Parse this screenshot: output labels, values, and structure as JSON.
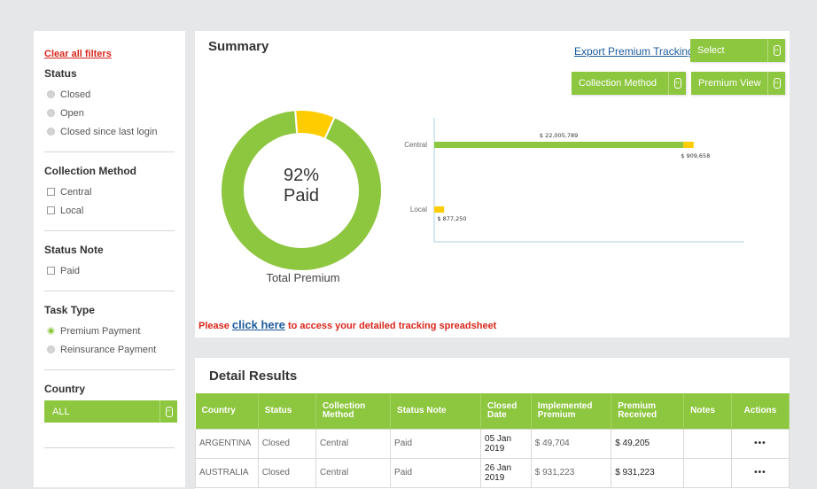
{
  "sidebar": {
    "clear_filters": "Clear all filters",
    "status": {
      "title": "Status",
      "options": [
        "Closed",
        "Open",
        "Closed since last login"
      ]
    },
    "collection_method": {
      "title": "Collection Method",
      "options": [
        "Central",
        "Local"
      ]
    },
    "status_note": {
      "title": "Status Note",
      "options": [
        "Paid"
      ]
    },
    "task_type": {
      "title": "Task Type",
      "options": [
        "Premium Payment",
        "Reinsurance Payment"
      ],
      "selected": "Premium Payment"
    },
    "country": {
      "title": "Country",
      "value": "ALL"
    }
  },
  "summary": {
    "title": "Summary",
    "export_link": "Export Premium Tracking",
    "select_label": "Select",
    "collection_method_btn": "Collection Method",
    "premium_view_btn": "Premium View",
    "donut_center": "92% Paid",
    "donut_caption": "Total Premium",
    "note_prefix": "Please ",
    "note_link": "click here",
    "note_suffix": " to access your detailed tracking spreadsheet",
    "colors": {
      "paid": "#8dc63f",
      "unpaid": "#ffcc00",
      "accent": "#8dc63f",
      "link": "#1c5b9c",
      "alert": "#d9261c"
    }
  },
  "chart_data": [
    {
      "type": "pie",
      "title": "Total Premium",
      "labels": [
        "Paid",
        "Unpaid"
      ],
      "values": [
        92,
        8
      ]
    },
    {
      "type": "bar",
      "orientation": "horizontal",
      "categories": [
        "Central",
        "Local"
      ],
      "series": [
        {
          "values": [
            22005789,
            0
          ]
        },
        {
          "values": [
            909658,
            877250
          ]
        }
      ],
      "data_labels": {
        "Central": [
          "$ 22,005,789",
          "$ 909,658"
        ],
        "Local": [
          "",
          "$ 877,250"
        ]
      },
      "xlim": [
        0,
        27000000
      ]
    }
  ],
  "detail": {
    "title": "Detail Results",
    "columns": [
      "Country",
      "Status",
      "Collection Method",
      "Status Note",
      "Closed Date",
      "Implemented Premium",
      "Premium Received",
      "Notes",
      "Actions"
    ],
    "rows": [
      [
        "ARGENTINA",
        "Closed",
        "Central",
        "Paid",
        "05 Jan 2019",
        "$ 49,704",
        "$ 49,205",
        "",
        "•••"
      ],
      [
        "AUSTRALIA",
        "Closed",
        "Central",
        "Paid",
        "26 Jan 2019",
        "$ 931,223",
        "$ 931,223",
        "",
        "•••"
      ]
    ]
  }
}
